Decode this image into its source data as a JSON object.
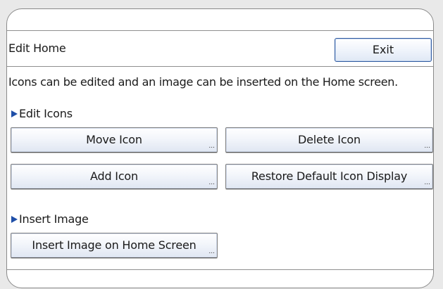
{
  "header": {
    "title": "Edit Home",
    "exit_label": "Exit"
  },
  "description": "Icons can be edited and an image can be inserted on the Home screen.",
  "edit_icons": {
    "heading": "Edit Icons",
    "move_label": "Move Icon",
    "delete_label": "Delete Icon",
    "add_label": "Add Icon",
    "restore_label": "Restore Default Icon Display"
  },
  "insert_image": {
    "heading": "Insert Image",
    "insert_label": "Insert Image on Home Screen"
  },
  "ellipsis": "...",
  "colors": {
    "accent": "#1f4fa8",
    "exit_border": "#2f5aa0"
  }
}
